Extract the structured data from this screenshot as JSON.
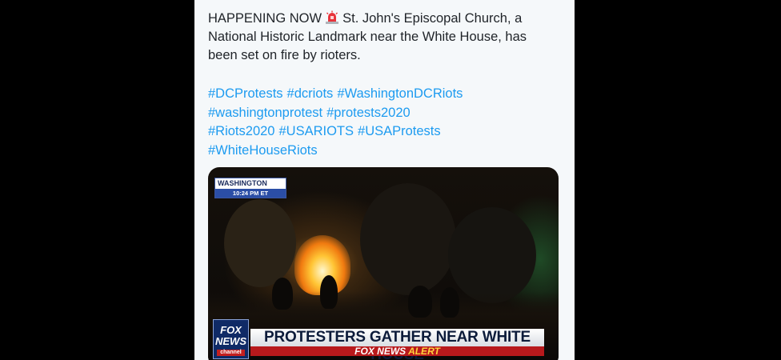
{
  "tweet": {
    "text_part1": "HAPPENING NOW",
    "emoji_icon": "police-light-icon",
    "text_part2": "St. John's Episcopal Church, a",
    "text_line2": "National Historic Landmark near the White House, has",
    "text_line3": "been set on fire by rioters.",
    "hashtag_rows": [
      [
        "#DCProtests",
        "#dcriots",
        "#WashingtonDCRiots"
      ],
      [
        "#washingtonprotest",
        "#protests2020"
      ],
      [
        "#Riots2020",
        "#USARIOTS",
        "#USAProtests"
      ],
      [
        "#WhiteHouseRiots"
      ]
    ],
    "hashtag_color": "#1d9bf0"
  },
  "media": {
    "location_label": "WASHINGTON",
    "time_label": "10:24 PM ET",
    "network_logo": "FOX NEWS",
    "network_logo_line1": "FOX",
    "network_logo_line2": "NEWS",
    "network_logo_line3": "channel",
    "headline": "PROTESTERS GATHER NEAR WHITE HOUSE",
    "alert_prefix": "FOX NEWS",
    "alert_suffix": "ALERT"
  }
}
